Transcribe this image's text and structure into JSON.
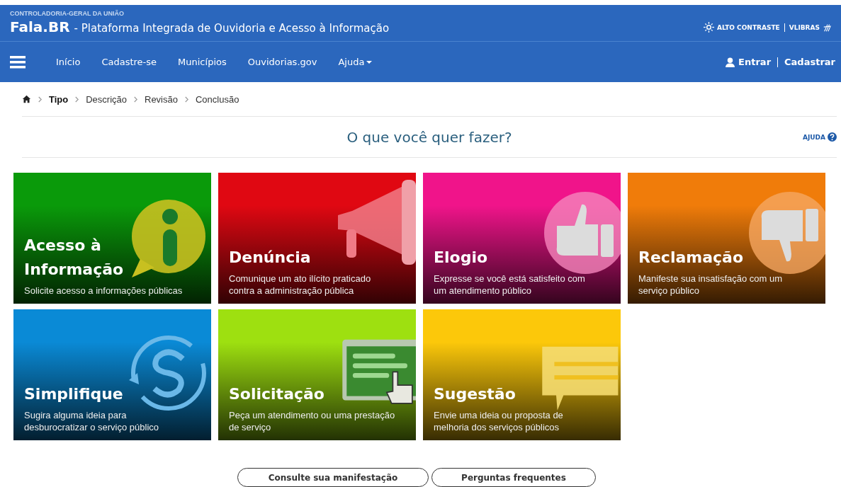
{
  "header": {
    "agency": "CONTROLADORIA-GERAL DA UNIÃO",
    "brand": "Fala.BR",
    "subtitle": "- Plataforma Integrada de Ouvidoria e Acesso à Informação",
    "accessibility": [
      {
        "kind": "contrast",
        "label": "ALTO CONTRASTE"
      },
      {
        "kind": "libras",
        "label": "VLIBRAS"
      }
    ]
  },
  "nav": {
    "items": [
      {
        "label": "Início",
        "dropdown": false
      },
      {
        "label": "Cadastre-se",
        "dropdown": false
      },
      {
        "label": "Municípios",
        "dropdown": false
      },
      {
        "label": "Ouvidorias.gov",
        "dropdown": false
      },
      {
        "label": "Ajuda",
        "dropdown": true
      }
    ],
    "account": [
      {
        "kind": "login",
        "label": "Entrar"
      },
      {
        "kind": "register",
        "label": "Cadastrar"
      }
    ]
  },
  "breadcrumb": [
    {
      "label": "Tipo",
      "selected": true
    },
    {
      "label": "Descrição",
      "selected": false
    },
    {
      "label": "Revisão",
      "selected": false
    },
    {
      "label": "Conclusão",
      "selected": false
    }
  ],
  "heading": "O que você quer fazer?",
  "help": "AJUDA",
  "cards": [
    {
      "kind": "info",
      "color": "#0a9a0a",
      "title": "Acesso à Informação",
      "description": "Solicite acesso a informações públicas"
    },
    {
      "kind": "megaphone",
      "color": "#e00812",
      "title": "Denúncia",
      "description": "Comunique um ato ilícito praticado contra a administração pública"
    },
    {
      "kind": "thumbs-up",
      "color": "#f0148a",
      "title": "Elogio",
      "description": "Expresse se você está satisfeito com um atendimento público"
    },
    {
      "kind": "thumbs-down",
      "color": "#f07c0a",
      "title": "Reclamação",
      "description": "Manifeste sua insatisfação com um serviço público"
    },
    {
      "kind": "cycle",
      "color": "#0a8ad6",
      "title": "Simplifique",
      "description": "Sugira alguma ideia para desburocratizar o serviço público"
    },
    {
      "kind": "screen",
      "color": "#9ee010",
      "title": "Solicitação",
      "description": "Peça um atendimento ou uma prestação de serviço"
    },
    {
      "kind": "speech",
      "color": "#fcc80a",
      "title": "Sugestão",
      "description": "Envie uma ideia ou proposta de melhoria dos serviços públicos"
    }
  ],
  "buttons": [
    "Consulte sua manifestação",
    "Perguntas frequentes"
  ]
}
